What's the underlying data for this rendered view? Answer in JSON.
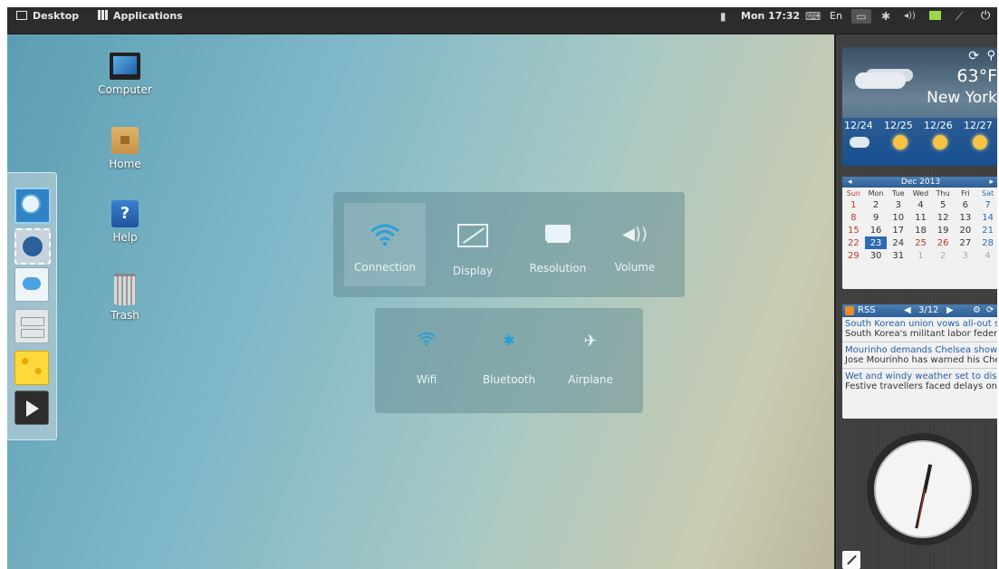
{
  "top_panel": {
    "desktop_label": "Desktop",
    "applications_label": "Applications",
    "clock": "Mon 17:32",
    "language": "En"
  },
  "desktop_icons": [
    {
      "label": "Computer",
      "icon": "computer-icon"
    },
    {
      "label": "Home",
      "icon": "home-folder-icon"
    },
    {
      "label": "Help",
      "icon": "help-icon"
    },
    {
      "label": "Trash",
      "icon": "trash-icon"
    }
  ],
  "dock": [
    {
      "icon": "chromium-icon"
    },
    {
      "icon": "mail-stamp-icon"
    },
    {
      "icon": "chat-icon"
    },
    {
      "icon": "file-cabinet-icon"
    },
    {
      "icon": "cheese-icon"
    },
    {
      "icon": "video-player-icon"
    }
  ],
  "settings": {
    "tiles": [
      {
        "label": "Connection",
        "icon": "wifi-icon"
      },
      {
        "label": "Display",
        "icon": "display-icon"
      },
      {
        "label": "Resolution",
        "icon": "monitor-icon"
      },
      {
        "label": "Volume",
        "icon": "speaker-icon"
      }
    ],
    "connection_options": [
      {
        "label": "Wifi",
        "icon": "wifi-icon"
      },
      {
        "label": "Bluetooth",
        "icon": "bluetooth-icon"
      },
      {
        "label": "Airplane",
        "icon": "airplane-icon"
      }
    ]
  },
  "weather": {
    "temperature": "63°F",
    "city": "New York",
    "forecast": [
      {
        "date": "12/24",
        "icon": "snow-icon"
      },
      {
        "date": "12/25",
        "icon": "sunny-icon"
      },
      {
        "date": "12/26",
        "icon": "sunny-icon"
      },
      {
        "date": "12/27",
        "icon": "sunny-icon"
      }
    ]
  },
  "calendar": {
    "month": "Dec 2013",
    "weekdays": [
      "Sun",
      "Mon",
      "Tue",
      "Wed",
      "Thu",
      "Fri",
      "Sat"
    ],
    "weeks": [
      [
        "1",
        "2",
        "3",
        "4",
        "5",
        "6",
        "7"
      ],
      [
        "8",
        "9",
        "10",
        "11",
        "12",
        "13",
        "14"
      ],
      [
        "15",
        "16",
        "17",
        "18",
        "19",
        "20",
        "21"
      ],
      [
        "22",
        "23",
        "24",
        "25",
        "26",
        "27",
        "28"
      ],
      [
        "29",
        "30",
        "31",
        "1",
        "2",
        "3",
        "4"
      ]
    ],
    "today": "23"
  },
  "rss": {
    "title": "RSS",
    "position": "3/12",
    "items": [
      {
        "headline": "South Korean union vows all-out st···",
        "summary": "South Korea's militant labor federa···"
      },
      {
        "headline": "Mourinho demands Chelsea show ···",
        "summary": "Jose Mourinho has warned his Chel···"
      },
      {
        "headline": "Wet and windy weather set to disr···",
        "summary": "Festive travellers faced delays on ···"
      }
    ]
  },
  "colors": {
    "accent": "#2a9fd6",
    "panel_bg": "#2b2d2d",
    "calendar_sunday": "#c0392b",
    "calendar_saturday": "#2a6db3",
    "rss_link": "#1f5fa8"
  }
}
